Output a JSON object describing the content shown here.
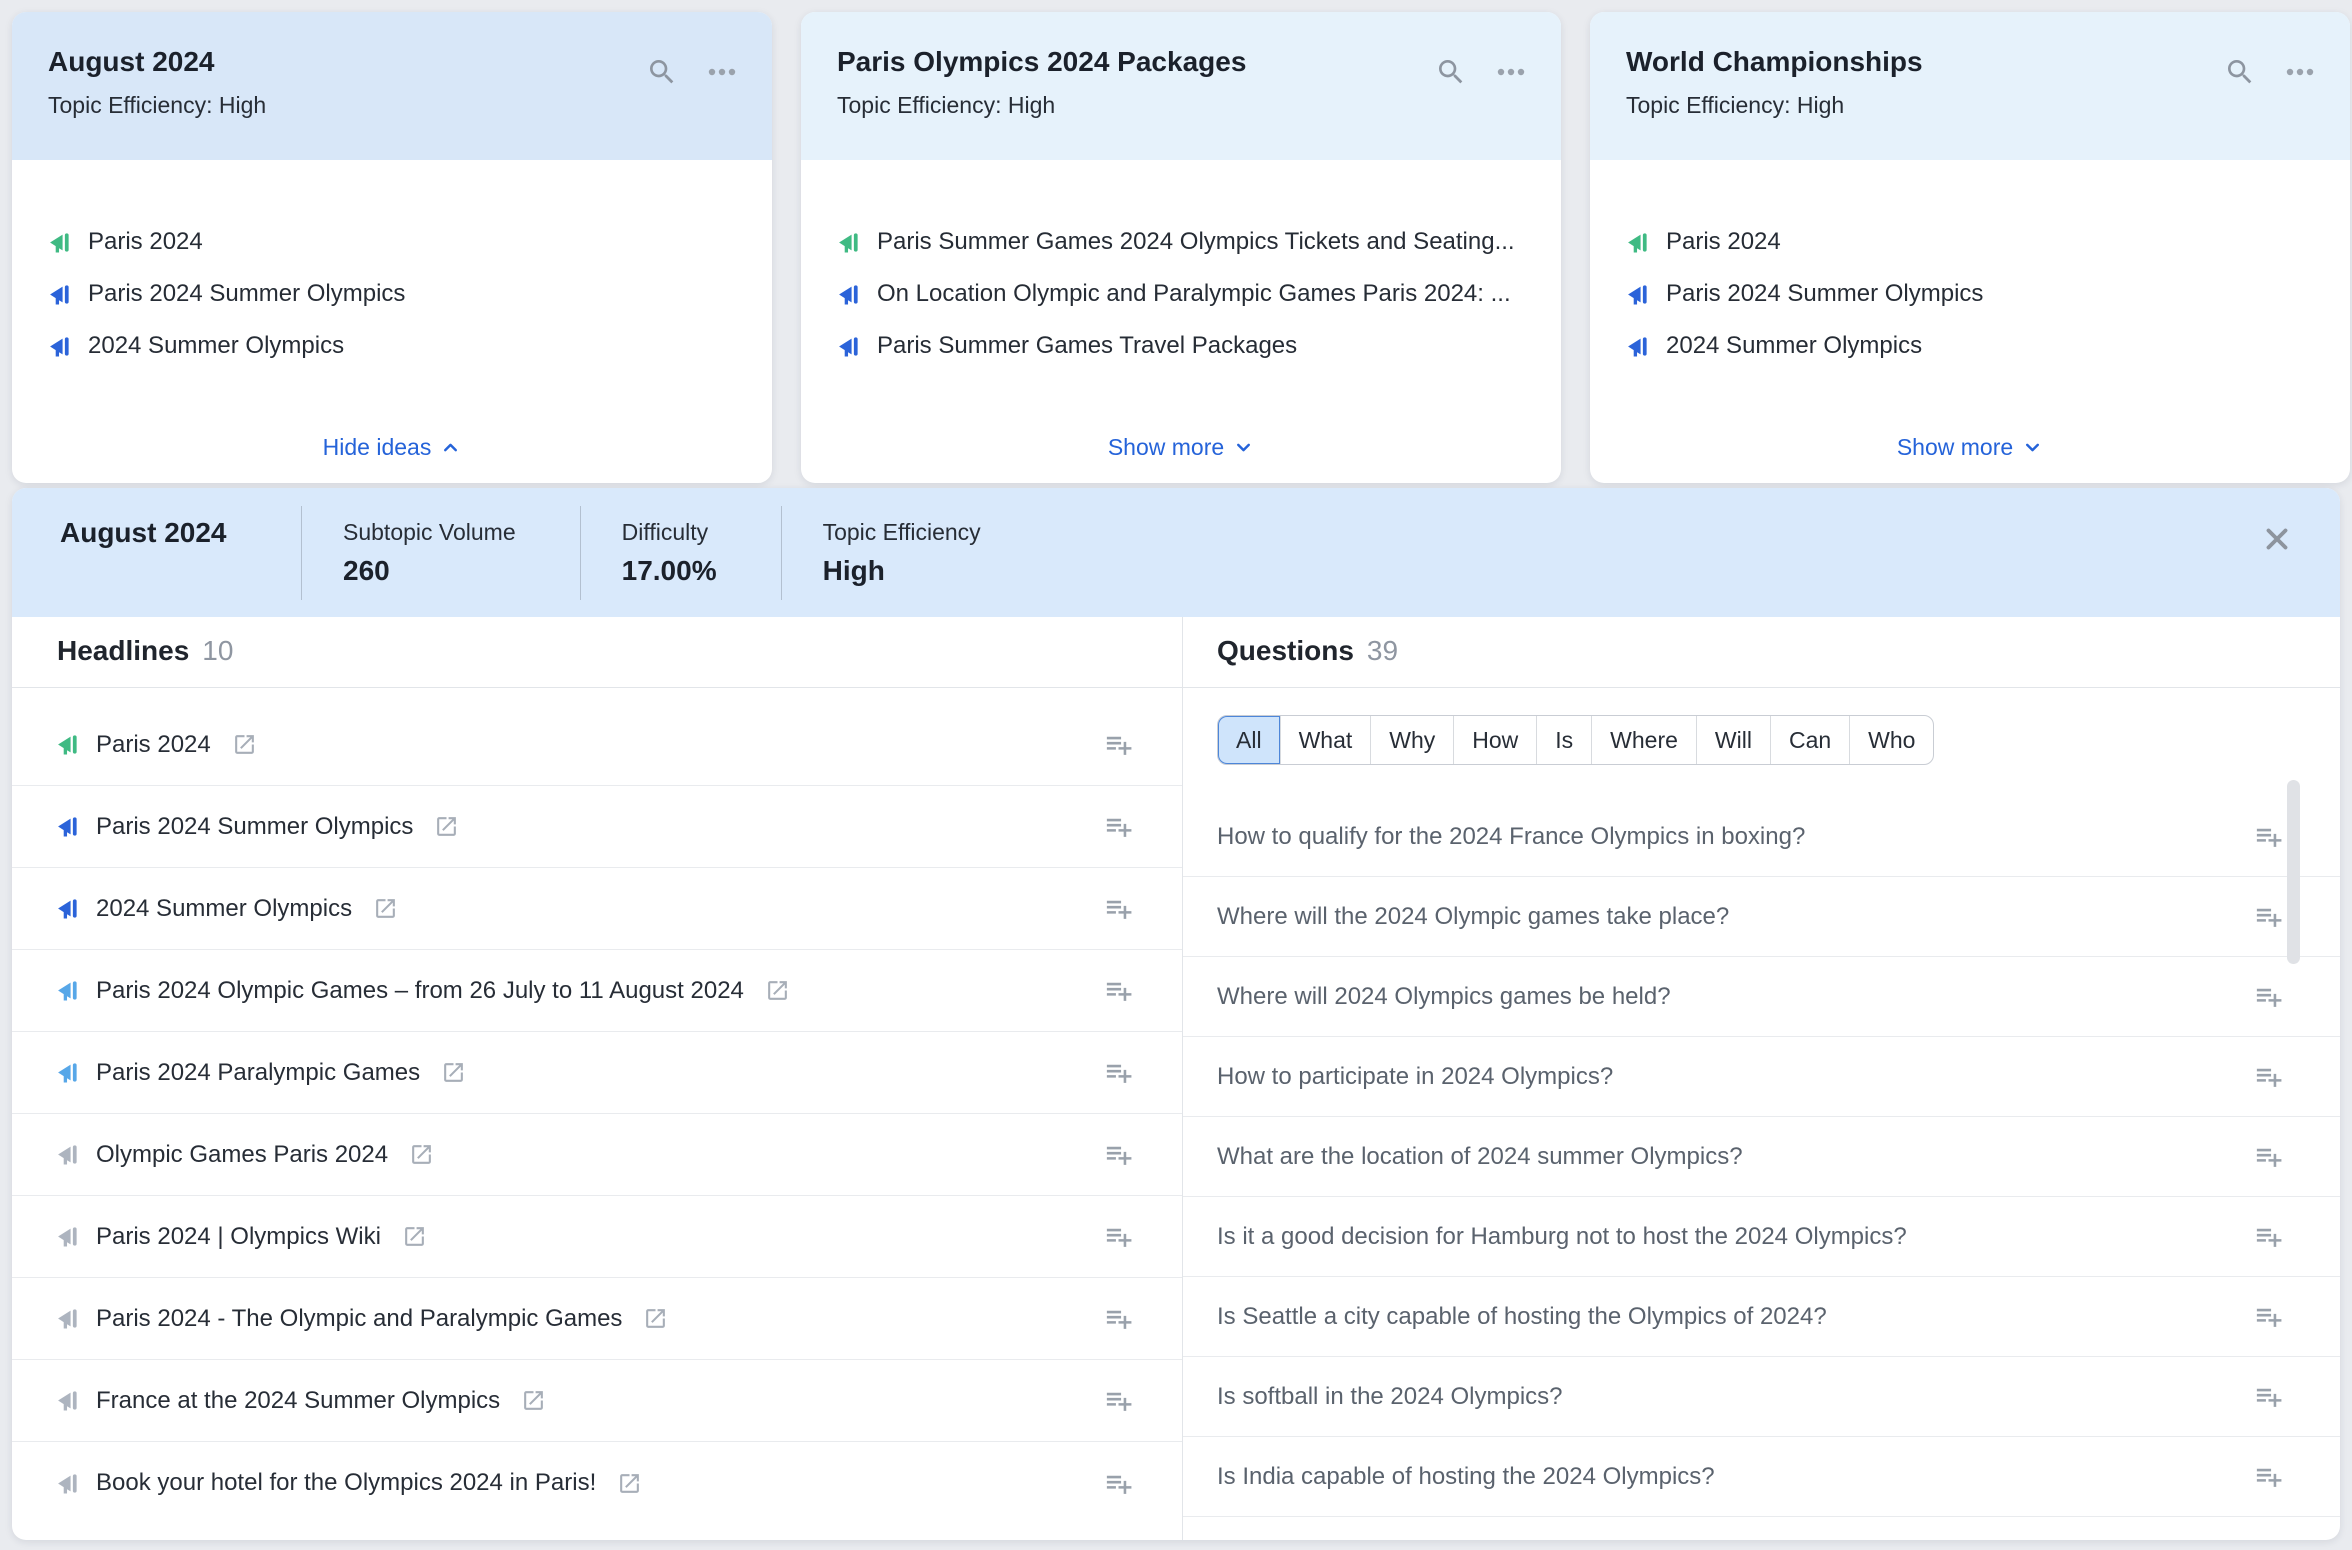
{
  "cards": [
    {
      "title": "August 2024",
      "subtitle": "Topic Efficiency: High",
      "selected": true,
      "items": [
        {
          "text": "Paris 2024",
          "icon_color": "green"
        },
        {
          "text": "Paris 2024 Summer Olympics",
          "icon_color": "blue"
        },
        {
          "text": "2024 Summer Olympics",
          "icon_color": "blue"
        }
      ],
      "footer_label": "Hide ideas"
    },
    {
      "title": "Paris Olympics 2024 Packages",
      "subtitle": "Topic Efficiency: High",
      "selected": false,
      "items": [
        {
          "text": "Paris Summer Games 2024 Olympics Tickets and Seating...",
          "icon_color": "green"
        },
        {
          "text": "On Location Olympic and Paralympic Games Paris 2024: ...",
          "icon_color": "blue"
        },
        {
          "text": "Paris Summer Games Travel Packages",
          "icon_color": "blue"
        }
      ],
      "footer_label": "Show more"
    },
    {
      "title": "World Championships",
      "subtitle": "Topic Efficiency: High",
      "selected": false,
      "items": [
        {
          "text": "Paris 2024",
          "icon_color": "green"
        },
        {
          "text": "Paris 2024 Summer Olympics",
          "icon_color": "blue"
        },
        {
          "text": "2024 Summer Olympics",
          "icon_color": "blue"
        }
      ],
      "footer_label": "Show more"
    }
  ],
  "detail": {
    "title": "August 2024",
    "stats": [
      {
        "label": "Subtopic Volume",
        "value": "260"
      },
      {
        "label": "Difficulty",
        "value": "17.00%"
      },
      {
        "label": "Topic Efficiency",
        "value": "High"
      }
    ],
    "headlines": {
      "title": "Headlines",
      "count": "10",
      "items": [
        {
          "text": "Paris 2024",
          "icon_color": "green"
        },
        {
          "text": "Paris 2024 Summer Olympics",
          "icon_color": "blue"
        },
        {
          "text": "2024 Summer Olympics",
          "icon_color": "blue"
        },
        {
          "text": "Paris 2024 Olympic Games – from 26 July to 11 August 2024",
          "icon_color": "sky"
        },
        {
          "text": "Paris 2024 Paralympic Games",
          "icon_color": "sky"
        },
        {
          "text": "Olympic Games Paris 2024",
          "icon_color": "gray"
        },
        {
          "text": "Paris 2024 | Olympics Wiki",
          "icon_color": "gray"
        },
        {
          "text": "Paris 2024 - The Olympic and Paralympic Games",
          "icon_color": "gray"
        },
        {
          "text": "France at the 2024 Summer Olympics",
          "icon_color": "gray"
        },
        {
          "text": "Book your hotel for the Olympics 2024 in Paris!",
          "icon_color": "gray"
        }
      ]
    },
    "questions": {
      "title": "Questions",
      "count": "39",
      "selected_filter": "All",
      "filters": [
        "All",
        "What",
        "Why",
        "How",
        "Is",
        "Where",
        "Will",
        "Can",
        "Who"
      ],
      "items": [
        {
          "text": "How to qualify for the 2024 France Olympics in boxing?"
        },
        {
          "text": "Where will the 2024 Olympic games take place?"
        },
        {
          "text": "Where will 2024 Olympics games be held?"
        },
        {
          "text": "How to participate in 2024 Olympics?"
        },
        {
          "text": "What are the location of 2024 summer Olympics?"
        },
        {
          "text": "Is it a good decision for Hamburg not to host the 2024 Olympics?"
        },
        {
          "text": "Is Seattle a city capable of hosting the Olympics of 2024?"
        },
        {
          "text": "Is softball in the 2024 Olympics?"
        },
        {
          "text": "Is India capable of hosting the 2024 Olympics?"
        }
      ]
    }
  },
  "colors": {
    "accent_blue": "#2563d9",
    "selected_card_header": "#d8e7f8",
    "card_header": "#e6f2fb",
    "detail_header": "#d9e9fb",
    "megaphone_green": "#3fba83",
    "megaphone_blue": "#2b63d9",
    "megaphone_sky": "#57a7e8",
    "megaphone_gray": "#adb4bf"
  }
}
